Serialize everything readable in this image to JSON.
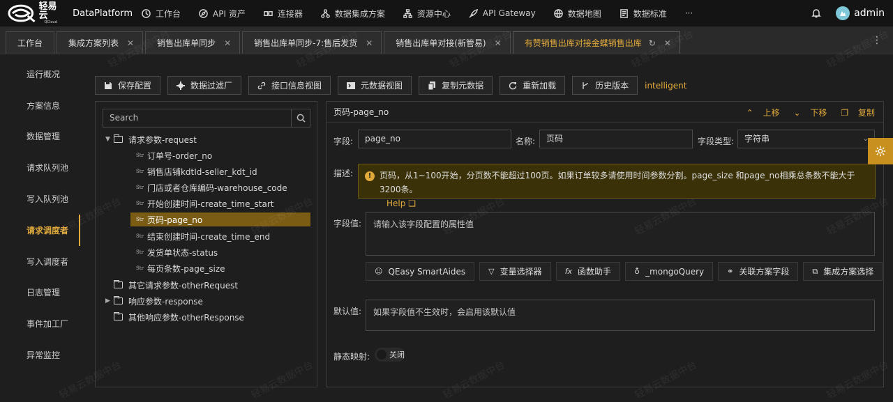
{
  "topnav": {
    "brand": "轻易云",
    "brand_sub": "QCloud",
    "platform": "DataPlatform",
    "items": [
      {
        "label": "工作台",
        "icon": "clock-icon"
      },
      {
        "label": "API 资产",
        "icon": "compass-icon"
      },
      {
        "label": "连接器",
        "icon": "connector-icon"
      },
      {
        "label": "数据集成方案",
        "icon": "network-icon"
      },
      {
        "label": "资源中心",
        "icon": "hierarchy-icon"
      },
      {
        "label": "API Gateway",
        "icon": "rocket-icon"
      },
      {
        "label": "数据地图",
        "icon": "globe-icon"
      },
      {
        "label": "数据标准",
        "icon": "document-icon"
      },
      {
        "label": "···",
        "icon": "more-icon"
      }
    ],
    "user": "admin"
  },
  "tabs": [
    {
      "label": "工作台",
      "closable": false
    },
    {
      "label": "集成方案列表",
      "closable": true
    },
    {
      "label": "销售出库单同步",
      "closable": true
    },
    {
      "label": "销售出库单同步-7:售后发货",
      "closable": true
    },
    {
      "label": "销售出库单对接(新管易)",
      "closable": true
    },
    {
      "label": "有赞销售出库对接金蝶销售出库",
      "closable": true,
      "active": true
    }
  ],
  "sidebar": {
    "items": [
      {
        "label": "运行概况"
      },
      {
        "label": "方案信息"
      },
      {
        "label": "数据管理"
      },
      {
        "label": "请求队列池"
      },
      {
        "label": "写入队列池"
      },
      {
        "label": "请求调度者",
        "active": true
      },
      {
        "label": "写入调度者"
      },
      {
        "label": "日志管理"
      },
      {
        "label": "事件加工厂"
      },
      {
        "label": "异常监控"
      }
    ]
  },
  "toolbar": {
    "buttons": [
      {
        "label": "保存配置",
        "icon": "save-icon"
      },
      {
        "label": "数据过滤厂",
        "icon": "filter-gear-icon"
      },
      {
        "label": "接口信息视图",
        "icon": "link-icon"
      },
      {
        "label": "元数据视图",
        "icon": "terminal-icon"
      },
      {
        "label": "复制元数据",
        "icon": "copy-icon"
      },
      {
        "label": "重新加载",
        "icon": "reload-icon"
      },
      {
        "label": "历史版本",
        "icon": "branch-icon"
      }
    ],
    "mode": "intelligent"
  },
  "tree": {
    "search_placeholder": "Search",
    "str_tag": "Str",
    "nodes": [
      {
        "label": "请求参数-request",
        "type": "folder",
        "level": 0,
        "expanded": true
      },
      {
        "label": "订单号-order_no",
        "type": "str",
        "level": 1
      },
      {
        "label": "销售店铺kdtId-seller_kdt_id",
        "type": "str",
        "level": 1
      },
      {
        "label": "门店或者仓库编码-warehouse_code",
        "type": "str",
        "level": 1
      },
      {
        "label": "开始创建时间-create_time_start",
        "type": "str",
        "level": 1
      },
      {
        "label": "页码-page_no",
        "type": "str",
        "level": 1,
        "selected": true
      },
      {
        "label": "结束创建时间-create_time_end",
        "type": "str",
        "level": 1
      },
      {
        "label": "发货单状态-status",
        "type": "str",
        "level": 1
      },
      {
        "label": "每页条数-page_size",
        "type": "str",
        "level": 1
      },
      {
        "label": "其它请求参数-otherRequest",
        "type": "folder",
        "level": 0
      },
      {
        "label": "响应参数-response",
        "type": "folder",
        "level": 0,
        "collapsed": true
      },
      {
        "label": "其他响应参数-otherResponse",
        "type": "folder",
        "level": 0
      }
    ]
  },
  "panel": {
    "title": "页码-page_no",
    "actions": {
      "up": "上移",
      "down": "下移",
      "copy": "复制"
    },
    "field_label": "字段:",
    "field_value": "page_no",
    "name_label": "名称:",
    "name_value": "页码",
    "type_label": "字段类型:",
    "type_value": "字符串",
    "desc_label": "描述:",
    "desc_text": "页码，从1~100开始，分页数不能超过100页。如果订单较多请使用时间参数分割。page_size 和page_no相乘总条数不能大于3200条。",
    "desc_help": "Help",
    "value_label": "字段值:",
    "value_placeholder": "请输入该字段配置的属性值",
    "helper_buttons": [
      {
        "label": "QEasy SmartAides",
        "icon": "robot-icon"
      },
      {
        "label": "变量选择器",
        "icon": "funnel-icon"
      },
      {
        "label": "函数助手",
        "icon": "fx-icon"
      },
      {
        "label": "_mongoQuery",
        "icon": "bulb-icon"
      },
      {
        "label": "关联方案字段",
        "icon": "link-icon"
      },
      {
        "label": "集成方案选择",
        "icon": "blocks-icon"
      }
    ],
    "default_label": "默认值:",
    "default_placeholder": "如果字段值不生效时，会启用该默认值",
    "static_label": "静态映射:",
    "static_toggle": "关闭"
  },
  "watermark": "轻易云数据中台",
  "colors": {
    "accent": "#e0a93a",
    "selected_row": "#7a5c14"
  }
}
